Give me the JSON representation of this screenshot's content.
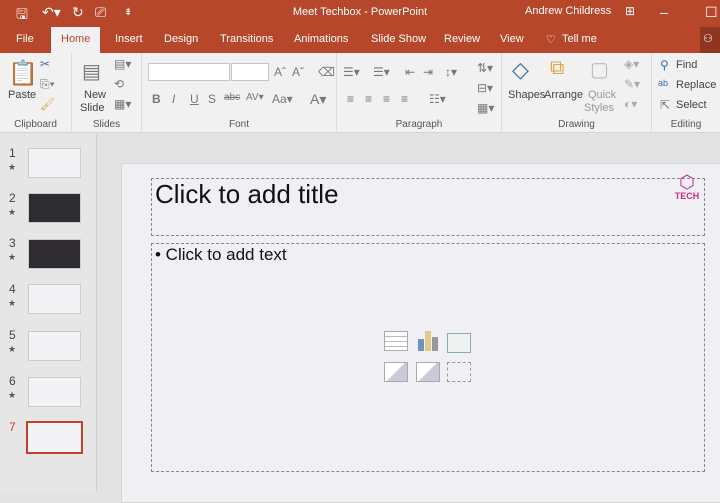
{
  "window": {
    "title": "Meet Techbox  -  PowerPoint",
    "user": "Andrew Childress"
  },
  "tabs": [
    "File",
    "Home",
    "Insert",
    "Design",
    "Transitions",
    "Animations",
    "Slide Show",
    "Review",
    "View",
    "Tell me"
  ],
  "ribbon": {
    "clipboard": {
      "label": "Clipboard",
      "paste": "Paste"
    },
    "slides": {
      "label": "Slides",
      "new_slide_1": "New",
      "new_slide_2": "Slide"
    },
    "font": {
      "label": "Font",
      "font_name": "",
      "font_size": ""
    },
    "paragraph": {
      "label": "Paragraph"
    },
    "drawing": {
      "label": "Drawing",
      "shapes": "Shapes",
      "arrange": "Arrange",
      "quick_styles_1": "Quick",
      "quick_styles_2": "Styles"
    },
    "editing": {
      "label": "Editing",
      "find": "Find",
      "replace": "Replace",
      "select": "Select"
    }
  },
  "slides": [
    {
      "n": "1"
    },
    {
      "n": "2"
    },
    {
      "n": "3"
    },
    {
      "n": "4"
    },
    {
      "n": "5"
    },
    {
      "n": "6"
    },
    {
      "n": "7"
    }
  ],
  "slide": {
    "title_placeholder": "Click to add title",
    "text_placeholder": "• Click to add text",
    "logo": "TECH"
  },
  "colors": {
    "accent": "#b7472a",
    "logo": "#c6308a"
  }
}
